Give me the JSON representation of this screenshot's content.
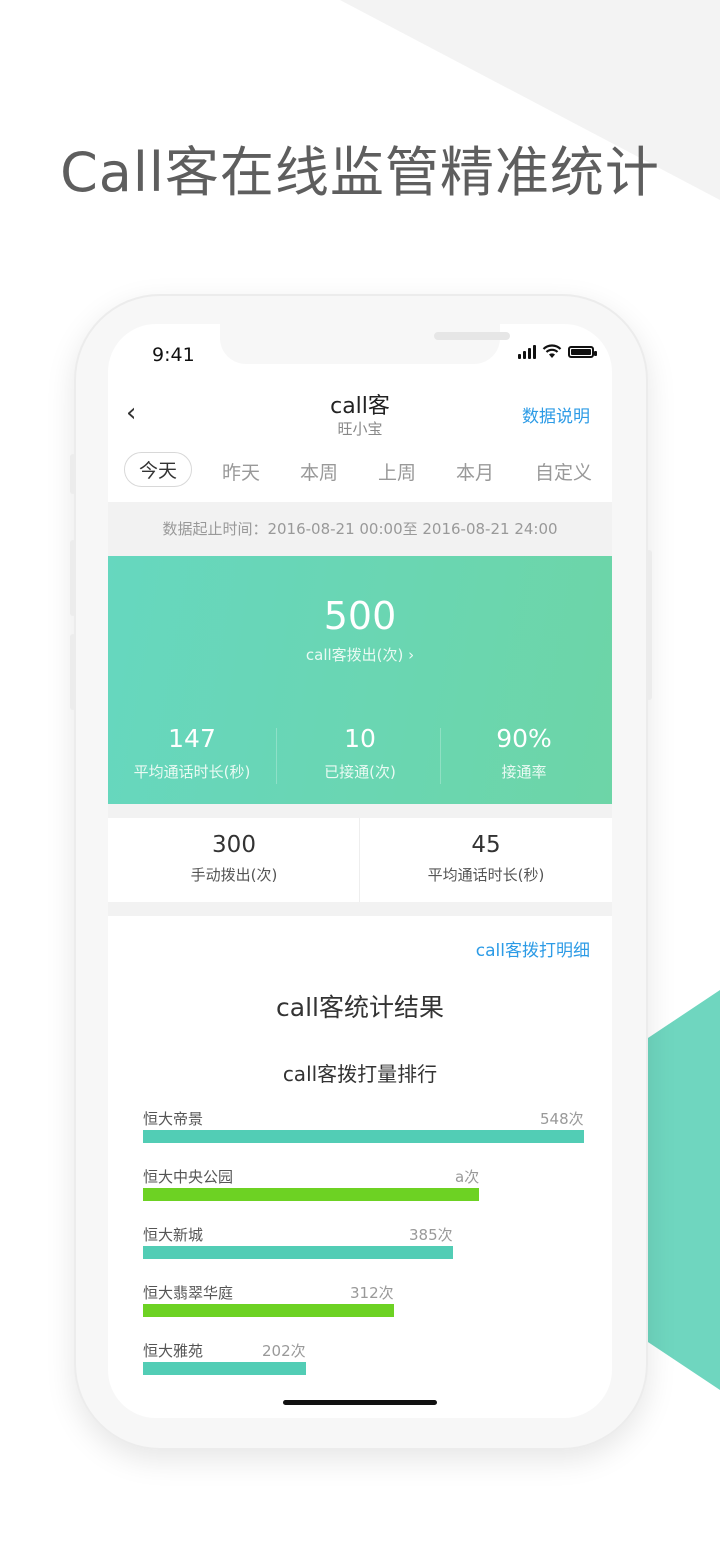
{
  "headline": "Call客在线监管精准统计",
  "status": {
    "time": "9:41"
  },
  "nav": {
    "back_icon": "‹",
    "title": "call客",
    "subtitle": "旺小宝",
    "link": "数据说明"
  },
  "tabs": [
    "今天",
    "昨天",
    "本周",
    "上周",
    "本月",
    "自定义"
  ],
  "range_text": "数据起止时间：2016-08-21 00:00至 2016-08-21 24:00",
  "hero": {
    "total": "500",
    "total_label": "call客拨出(次) ›",
    "stats": [
      {
        "value": "147",
        "label": "平均通话时长(秒)"
      },
      {
        "value": "10",
        "label": "已接通(次)"
      },
      {
        "value": "90%",
        "label": "接通率"
      }
    ]
  },
  "secondary": [
    {
      "value": "300",
      "label": "手动拨出(次)"
    },
    {
      "value": "45",
      "label": "平均通话时长(秒)"
    }
  ],
  "detail_link": "call客拨打明细",
  "section_title": "call客统计结果",
  "chart_title": "call客拨打量排行",
  "colors": {
    "teal": "#52cdb5",
    "green": "#6dd223",
    "link": "#2c9be6"
  },
  "chart_data": {
    "type": "bar",
    "orientation": "horizontal",
    "title": "call客拨打量排行",
    "categories": [
      "恒大帝景",
      "恒大中央公园",
      "恒大新城",
      "恒大翡翠华庭",
      "恒大雅苑"
    ],
    "values": [
      548,
      418,
      385,
      312,
      202
    ],
    "value_labels": [
      "548次",
      "a次",
      "385次",
      "312次",
      "202次"
    ],
    "bar_colors": [
      "#52cdb5",
      "#6dd223",
      "#52cdb5",
      "#6dd223",
      "#52cdb5"
    ],
    "xlim": [
      0,
      548
    ]
  }
}
